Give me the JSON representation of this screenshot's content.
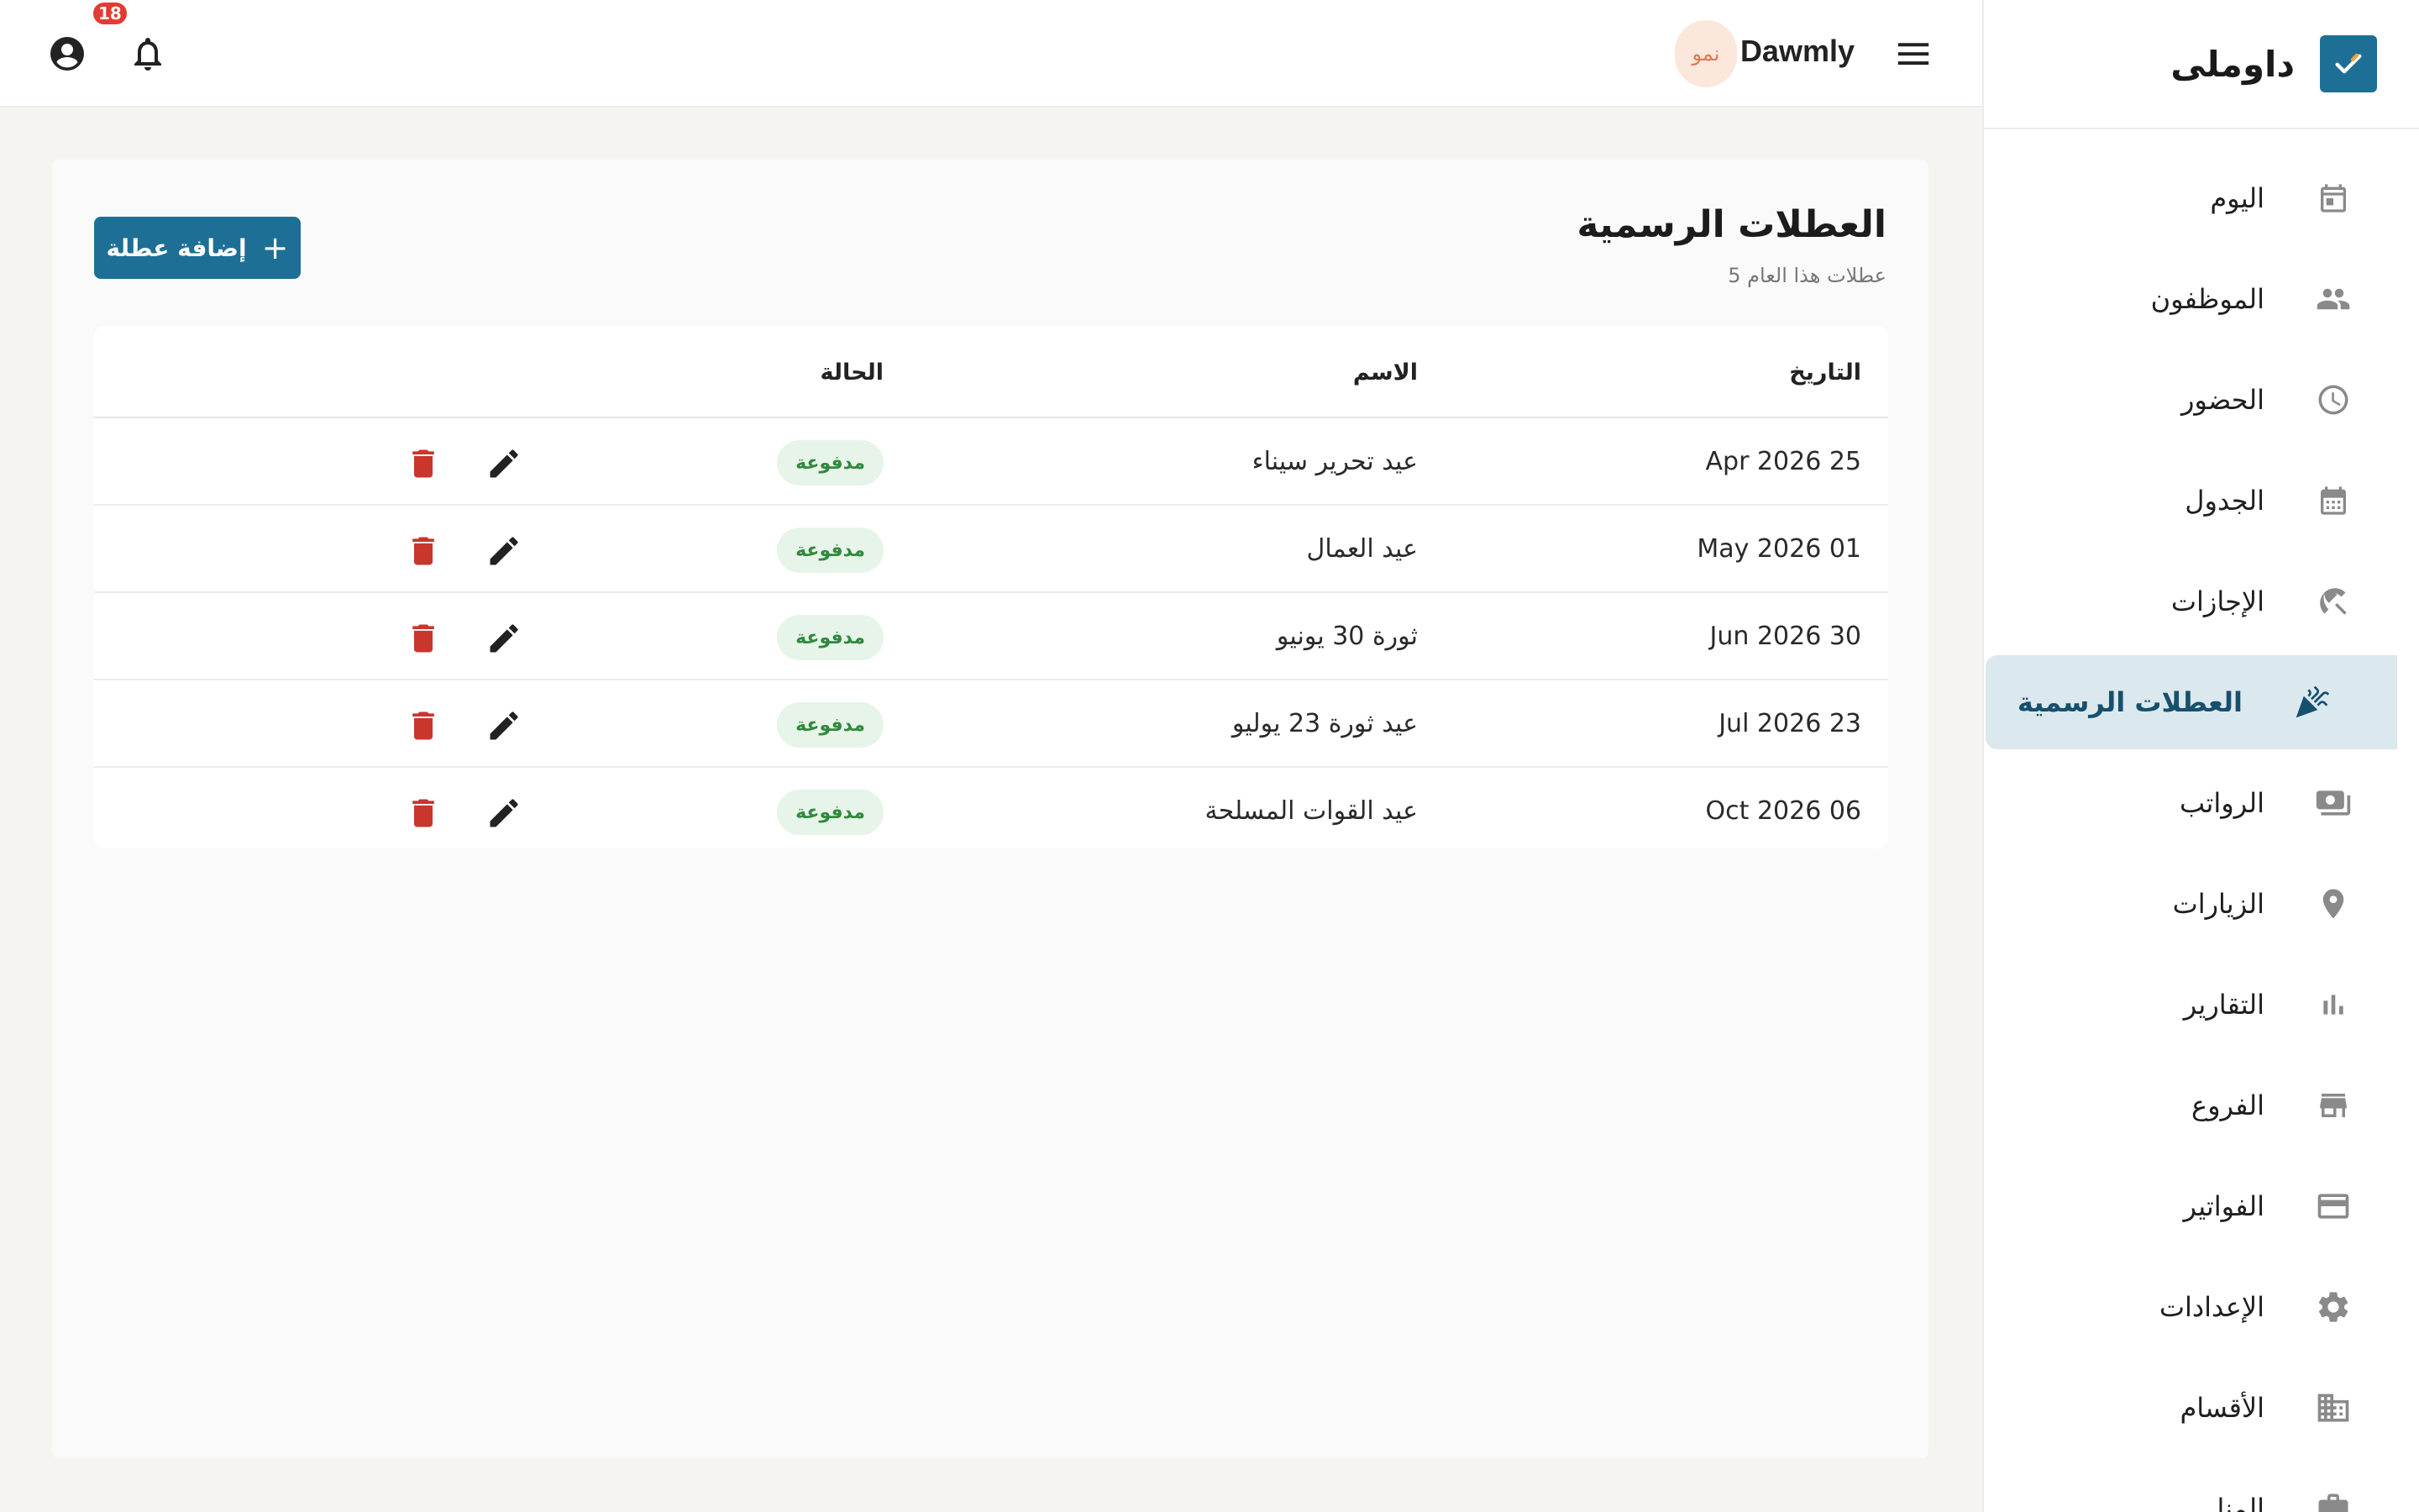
{
  "sidebar": {
    "brand": "داوملى",
    "items": [
      {
        "label": "اليوم",
        "icon": "calendar-today-icon"
      },
      {
        "label": "الموظفون",
        "icon": "people-icon"
      },
      {
        "label": "الحضور",
        "icon": "clock-icon"
      },
      {
        "label": "الجدول",
        "icon": "calendar-grid-icon"
      },
      {
        "label": "الإجازات",
        "icon": "beach-umbrella-icon"
      },
      {
        "label": "العطلات الرسمية",
        "icon": "celebration-icon",
        "active": true
      },
      {
        "label": "الرواتب",
        "icon": "payments-icon"
      },
      {
        "label": "الزيارات",
        "icon": "location-pin-icon"
      },
      {
        "label": "التقارير",
        "icon": "bar-chart-icon"
      },
      {
        "label": "الفروع",
        "icon": "store-icon"
      },
      {
        "label": "الفواتير",
        "icon": "credit-card-icon"
      },
      {
        "label": "الإعدادات",
        "icon": "gear-icon"
      },
      {
        "label": "الأقسام",
        "icon": "building-icon"
      },
      {
        "label": "المنا",
        "icon": "briefcase-icon"
      }
    ]
  },
  "topbar": {
    "company": "Dawmly",
    "avatar_text": "نمو",
    "notification_count": "18"
  },
  "page": {
    "title": "العطلات الرسمية",
    "subtitle": "5 عطلات هذا العام",
    "add_label": "إضافة عطلة"
  },
  "table": {
    "headers": {
      "date": "التاريخ",
      "name": "الاسم",
      "status": "الحالة"
    },
    "rows": [
      {
        "date": "Apr 2026 25",
        "name": "عيد تحرير سيناء",
        "status": "مدفوعة"
      },
      {
        "date": "May 2026 01",
        "name": "عيد العمال",
        "status": "مدفوعة"
      },
      {
        "date": "Jun 2026 30",
        "name": "ثورة 30 يونيو",
        "status": "مدفوعة"
      },
      {
        "date": "Jul 2026 23",
        "name": "عيد ثورة 23 يوليو",
        "status": "مدفوعة"
      },
      {
        "date": "Oct 2026 06",
        "name": "عيد القوات المسلحة",
        "status": "مدفوعة"
      }
    ]
  },
  "colors": {
    "primary": "#1e6f96",
    "active_bg": "#dbe8ee",
    "badge_bg": "#e7f4e9",
    "badge_text": "#2f8a3c",
    "delete": "#c8362c",
    "notification": "#e23b32"
  }
}
